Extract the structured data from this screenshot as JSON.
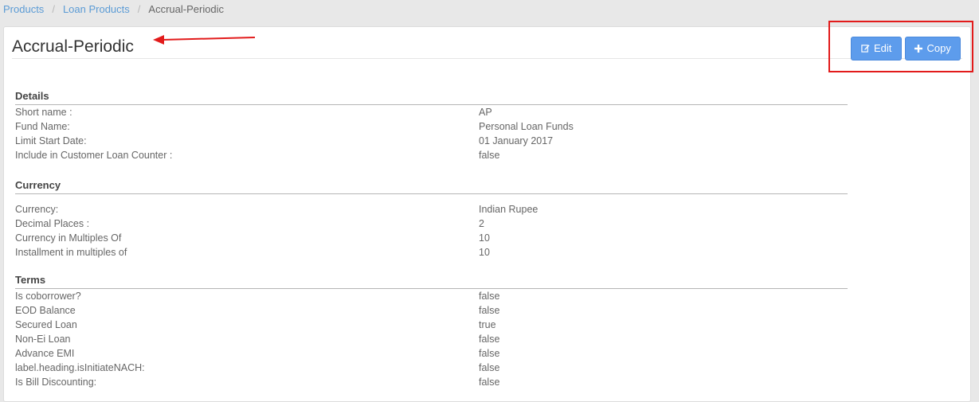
{
  "breadcrumb": {
    "items": [
      "Products",
      "Loan Products"
    ],
    "current": "Accrual-Periodic"
  },
  "header": {
    "title": "Accrual-Periodic",
    "edit_label": "Edit",
    "copy_label": "Copy"
  },
  "details": {
    "title": "Details",
    "rows": [
      {
        "label": "Short name :",
        "value": "AP"
      },
      {
        "label": "Fund Name:",
        "value": "Personal Loan Funds"
      },
      {
        "label": "Limit Start Date:",
        "value": "01 January 2017"
      },
      {
        "label": "Include in Customer Loan Counter :",
        "value": "false"
      }
    ]
  },
  "currency": {
    "title": "Currency",
    "rows": [
      {
        "label": "Currency:",
        "value": "Indian Rupee"
      },
      {
        "label": "Decimal Places :",
        "value": "2"
      },
      {
        "label": "Currency in Multiples Of",
        "value": "10"
      },
      {
        "label": "Installment in multiples of",
        "value": "10"
      }
    ]
  },
  "terms": {
    "title": "Terms",
    "rows": [
      {
        "label": "Is coborrower?",
        "value": "false"
      },
      {
        "label": "EOD Balance",
        "value": "false"
      },
      {
        "label": "Secured Loan",
        "value": "true"
      },
      {
        "label": "Non-Ei Loan",
        "value": "false"
      },
      {
        "label": "Advance EMI",
        "value": "false"
      },
      {
        "label": "label.heading.isInitiateNACH:",
        "value": "false"
      },
      {
        "label": "Is Bill Discounting:",
        "value": "false"
      }
    ]
  },
  "colors": {
    "button": "#5d9cec",
    "annotation": "#e21b1b",
    "link": "#5b9bd5"
  },
  "icons": {
    "edit": "edit-icon",
    "copy": "plus-icon"
  }
}
